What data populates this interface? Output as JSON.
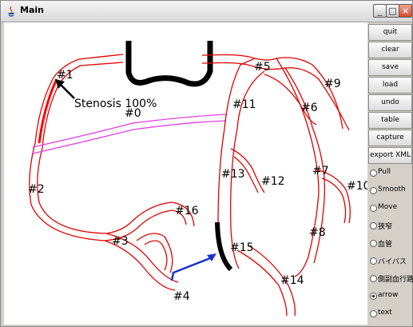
{
  "window": {
    "title": "Main"
  },
  "buttons": [
    {
      "id": "quit",
      "label": "quit"
    },
    {
      "id": "clear",
      "label": "clear"
    },
    {
      "id": "save",
      "label": "save"
    },
    {
      "id": "load",
      "label": "load"
    },
    {
      "id": "undo",
      "label": "undo"
    },
    {
      "id": "table",
      "label": "table"
    },
    {
      "id": "capture",
      "label": "capture"
    },
    {
      "id": "export-xml",
      "label": "export XML"
    }
  ],
  "modes": [
    {
      "label": "Pull",
      "selected": false
    },
    {
      "label": "Smooth",
      "selected": false
    },
    {
      "label": "Move",
      "selected": false
    },
    {
      "label": "狭窄",
      "selected": false
    },
    {
      "label": "血管",
      "selected": false
    },
    {
      "label": "バイパス",
      "selected": false
    },
    {
      "label": "側副血行路",
      "selected": false
    },
    {
      "label": "arrow",
      "selected": true
    },
    {
      "label": "text",
      "selected": false
    }
  ],
  "diagram": {
    "annotation": "Stenosis 100%",
    "labels": {
      "s0": "#0",
      "s1": "#1",
      "s2": "#2",
      "s3": "#3",
      "s4": "#4",
      "s5": "#5",
      "s6": "#6",
      "s7": "#7",
      "s8": "#8",
      "s9": "#9",
      "s10": "#10",
      "s11": "#11",
      "s12": "#12",
      "s13": "#13",
      "s14": "#14",
      "s15": "#15",
      "s16": "#16"
    },
    "colors": {
      "vessel": "#e00000",
      "bypass": "#e040e0",
      "stenosis": "#ff0000",
      "arrow_blue": "#1a33cc",
      "graft": "#000000"
    }
  }
}
